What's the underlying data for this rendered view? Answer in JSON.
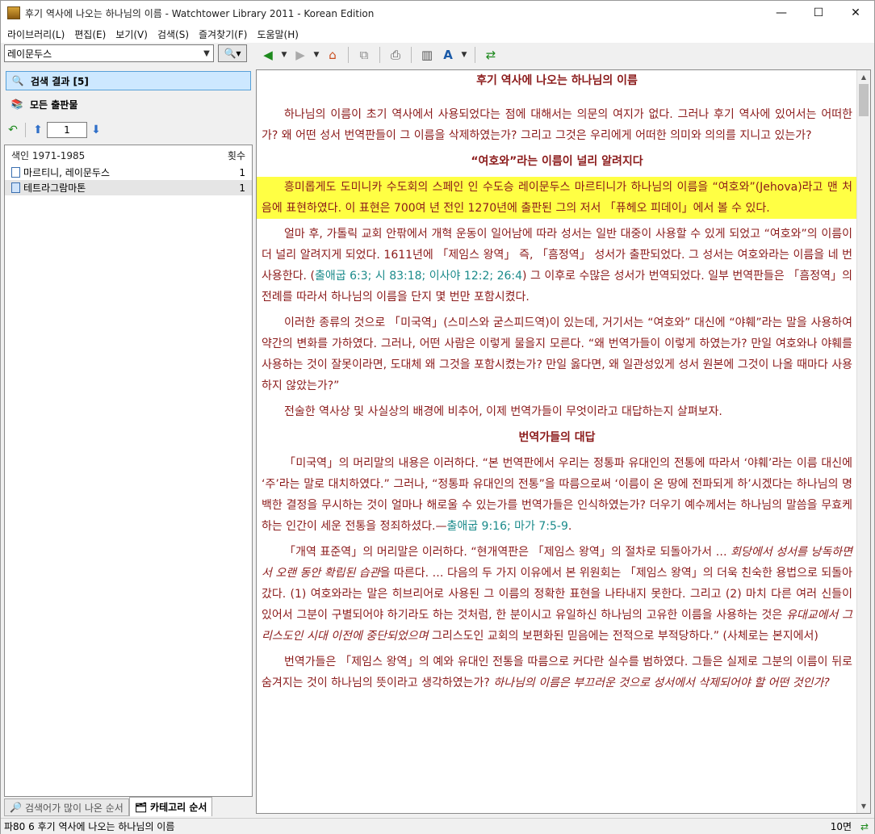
{
  "window": {
    "title": "후기 역사에 나오는 하나님의 이름 - Watchtower Library 2011 - Korean Edition",
    "controls": {
      "minimize": "—",
      "maximize": "☐",
      "close": "✕"
    }
  },
  "menu": [
    "라이브러리(L)",
    "편집(E)",
    "보기(V)",
    "검색(S)",
    "즐겨찾기(F)",
    "도움말(H)"
  ],
  "search": {
    "value": "레이문두스",
    "button_icon": "magnifier-icon"
  },
  "nav": {
    "results_label": "검색 결과 [5]",
    "all_label": "모든 출판물"
  },
  "pager": {
    "page_value": "1"
  },
  "list": {
    "header_title": "색인 1971-1985",
    "header_count": "횟수",
    "rows": [
      {
        "label": "마르티니, 레이문두스",
        "count": "1"
      },
      {
        "label": "테트라그람마톤",
        "count": "1"
      }
    ]
  },
  "bottom_tabs": [
    "검색어가 많이 나온 순서",
    "카테고리 순서"
  ],
  "article": {
    "title": "후기 역사에 나오는 하나님의 이름",
    "p1": "하나님의 이름이 초기 역사에서 사용되었다는 점에 대해서는 의문의 여지가 없다. 그러나 후기 역사에 있어서는 어떠한가? 왜 어떤 성서 번역판들이 그 이름을 삭제하였는가? 그리고 그것은 우리에게 어떠한 의미와 의의를 지니고 있는가?",
    "h1": "“여호와”라는 이름이 널리 알려지다",
    "p2": "흥미롭게도 도미니카 수도회의 스페인 인 수도승 레이문두스 마르티니가 하나님의 이름을 “여호와”(Jehova)라고 맨 처음에 표현하였다. 이 표현은 700여 년 전인 1270년에 출판된 그의 저서 「퓨헤오 피데이」에서 볼 수 있다.",
    "p3a": "얼마 후, 가톨릭 교회 안팎에서 개혁 운동이 일어남에 따라 성서는 일반 대중이 사용할 수 있게 되었고 “여호와”의 이름이 더 널리 알려지게 되었다. 1611년에 「제임스 왕역」 즉, 「흠정역」 성서가 출판되었다. 그 성서는 여호와라는 이름을 네 번 사용한다. (",
    "p3ref": "출애굽 6:3; 시 83:18; 이사야 12:2; 26:4",
    "p3b": ") 그 이후로 수많은 성서가 번역되었다. 일부 번역판들은 「흠정역」의 전례를 따라서 하나님의 이름을 단지 몇 번만 포함시켰다.",
    "p4": "이러한 종류의 것으로 「미국역」(스미스와 굳스피드역)이 있는데, 거기서는 “여호와” 대신에 “야훼”라는 말을 사용하여 약간의 변화를 가하였다. 그러나, 어떤 사람은 이렇게 물을지 모른다. “왜 번역가들이 이렇게 하였는가? 만일 여호와나 야훼를 사용하는 것이 잘못이라면, 도대체 왜 그것을 포함시켰는가? 만일 옳다면, 왜 일관성있게 성서 원본에 그것이 나올 때마다 사용하지 않았는가?”",
    "p5": "전술한 역사상 및 사실상의 배경에 비추어, 이제 번역가들이 무엇이라고 대답하는지 살펴보자.",
    "h2": "번역가들의 대답",
    "p6a": "「미국역」의 머리말의 내용은 이러하다. “본 번역판에서 우리는 정통파 유대인의 전통에 따라서 ‘야훼’라는 이름 대신에 ‘주’라는 말로 대치하였다.” 그러나, “정통파 유대인의 전통”을 따름으로써 ‘이름이 온 땅에 전파되게 하’시겠다는 하나님의 명백한 결정을 무시하는 것이 얼마나 해로울 수 있는가를 번역가들은 인식하였는가? 더우기 예수께서는 하나님의 말씀을 무효케 하는 인간이 세운 전통을 정죄하셨다.—",
    "p6ref": "출애굽 9:16; 마가 7:5-9",
    "p6b": ".",
    "p7a": "「개역 표준역」의 머리말은 이러하다. “현개역판은 「제임스 왕역」의 절차로 되돌아가서 … ",
    "p7i1": "회당에서 성서를 낭독하면서 오랜 동안 확립된 습관",
    "p7b": "을 따른다. … 다음의 두 가지 이유에서 본 위원회는 「제임스 왕역」의 더욱 친숙한 용법으로 되돌아갔다. (1) 여호와라는 말은 히브리어로 사용된 그 이름의 정확한 표현을 나타내지 못한다. 그리고 (2) 마치 다른 여러 신들이 있어서 그분이 구별되어야 하기라도 하는 것처럼, 한 분이시고 유일하신 하나님의 고유한 이름을 사용하는 것은 ",
    "p7i2": "유대교에서 그리스도인 시대 이전에 중단되었으며",
    "p7c": " 그리스도인 교회의 보편화된 믿음에는 전적으로 부적당하다.” (사체로는 본지에서)",
    "p8a": "번역가들은 「제임스 왕역」의 예와 유대인 전통을 따름으로 커다란 실수를 범하였다. 그들은 실제로 그분의 이름이 뒤로 숨겨지는 것이 하나님의 뜻이라고 생각하였는가? ",
    "p8i": "하나님의 이름은 부끄러운 것으로 성서에서 삭제되어야 할 어떤 것인가?"
  },
  "status": {
    "text": "파80 6 후기 역사에 나오는 하나님의 이름",
    "page": "10면"
  },
  "colors": {
    "article_text": "#8b1a1a",
    "highlight": "#ffff44",
    "reference": "#1a8a8a",
    "selected_nav": "#cde8ff"
  }
}
